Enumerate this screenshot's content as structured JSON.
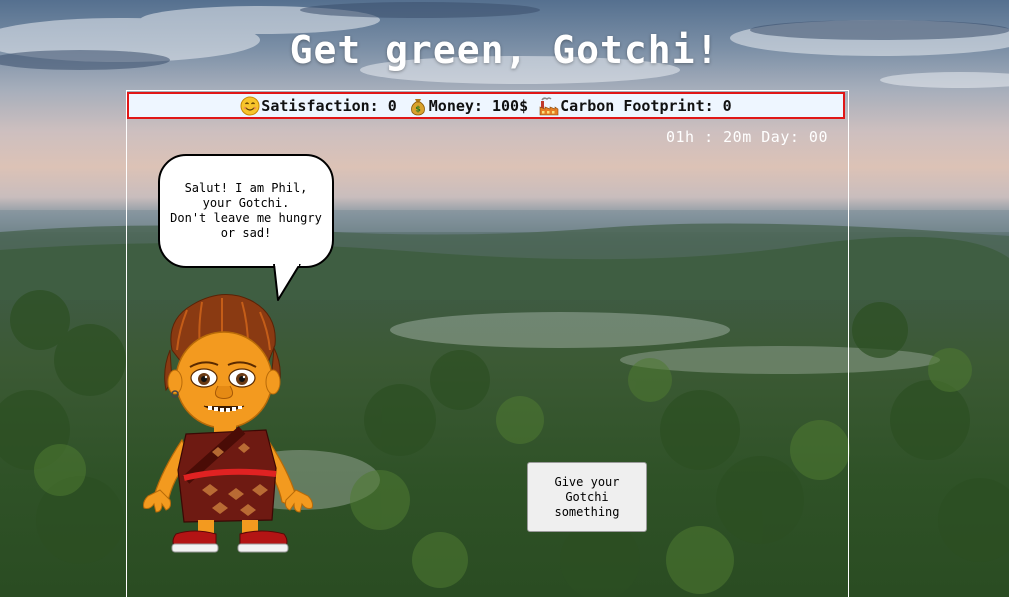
{
  "page": {
    "title": "Get green, Gotchi!"
  },
  "stats": {
    "satisfaction": {
      "icon": "smiley-icon",
      "label": "Satisfaction: 0"
    },
    "money": {
      "icon": "money-bag-icon",
      "label": "Money: 100$"
    },
    "carbon": {
      "icon": "factory-icon",
      "label": "Carbon Footprint: 0"
    }
  },
  "timer": {
    "text": "01h : 20m Day: 00"
  },
  "speech_bubble": {
    "lines": [
      "Salut! I am Phil,",
      "your Gotchi.",
      "Don't leave me hungry",
      "or sad!"
    ]
  },
  "action_button": {
    "label": "Give your Gotchi something"
  },
  "colors": {
    "stats_border": "#e01616",
    "stats_background": "#eef6ff",
    "button_background": "#efefef"
  }
}
